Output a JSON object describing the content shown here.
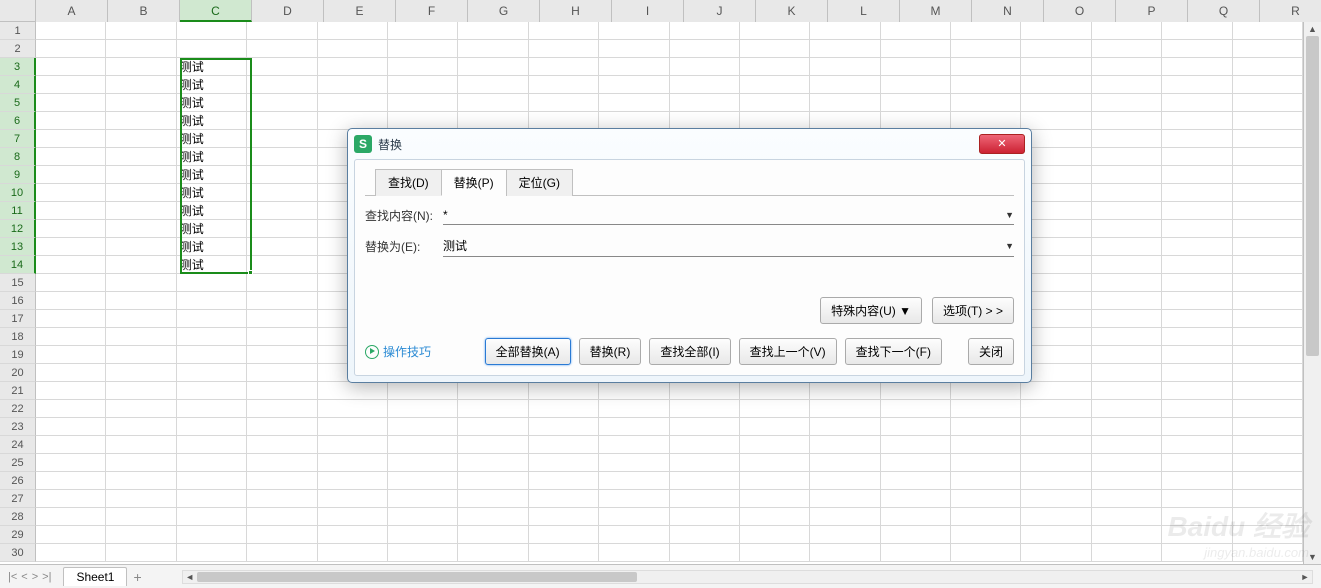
{
  "columns": [
    "A",
    "B",
    "C",
    "D",
    "E",
    "F",
    "G",
    "H",
    "I",
    "J",
    "K",
    "L",
    "M",
    "N",
    "O",
    "P",
    "Q",
    "R"
  ],
  "selectedCol": "C",
  "rowCount": 30,
  "selectedRows": [
    3,
    4,
    5,
    6,
    7,
    8,
    9,
    10,
    11,
    12,
    13,
    14
  ],
  "cellC": [
    "",
    "",
    "测试",
    "测试",
    "测试",
    "测试",
    "测试",
    "测试",
    "测试",
    "测试",
    "测试",
    "测试",
    "测试",
    "测试"
  ],
  "dialog": {
    "title": "替换",
    "tabs": {
      "find": "查找(D)",
      "replace": "替换(P)",
      "goto": "定位(G)"
    },
    "activeTab": "replace",
    "findLabel": "查找内容(N):",
    "findValue": "*",
    "replaceLabel": "替换为(E):",
    "replaceValue": "测试",
    "specialBtn": "特殊内容(U) ▼",
    "optionsBtn": "选项(T) > >",
    "tips": "操作技巧",
    "replaceAll": "全部替换(A)",
    "replaceOne": "替换(R)",
    "findAll": "查找全部(I)",
    "findPrev": "查找上一个(V)",
    "findNext": "查找下一个(F)",
    "close": "关闭"
  },
  "sheet": {
    "name": "Sheet1",
    "add": "+"
  },
  "watermark": {
    "brand": "Baidu 经验",
    "url": "jingyan.baidu.com"
  }
}
